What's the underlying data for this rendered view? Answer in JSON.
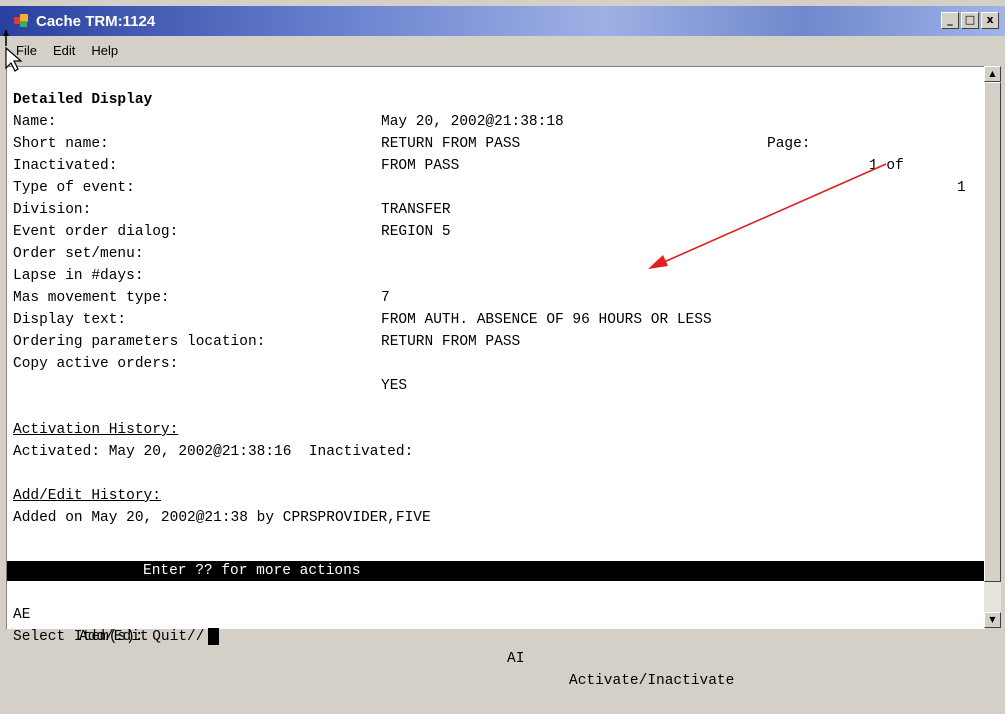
{
  "window": {
    "title": "Cache TRM:1124",
    "controls": [
      "_",
      "□",
      "x"
    ]
  },
  "menu": [
    "File",
    "Edit",
    "Help"
  ],
  "screen": {
    "header": {
      "left": "Detailed Display",
      "date": "May 20, 2002@21:38:18",
      "page_label": "Page:",
      "page_current": "1 of",
      "page_total": "1"
    },
    "fields": [
      {
        "label": "Name:",
        "value": "RETURN FROM PASS"
      },
      {
        "label": "Short name:",
        "value": "FROM PASS"
      },
      {
        "label": "Inactivated:",
        "value": ""
      },
      {
        "label": "Type of event:",
        "value": "TRANSFER"
      },
      {
        "label": "Division:",
        "value": "REGION 5"
      },
      {
        "label": "Event order dialog:",
        "value": ""
      },
      {
        "label": "Order set/menu:",
        "value": ""
      },
      {
        "label": "Lapse in #days:",
        "value": "7"
      },
      {
        "label": "Mas movement type:",
        "value": "FROM AUTH. ABSENCE OF 96 HOURS OR LESS"
      },
      {
        "label": "Display text:",
        "value": "RETURN FROM PASS"
      },
      {
        "label": "Ordering parameters location:",
        "value": ""
      },
      {
        "label": "Copy active orders:",
        "value": "YES"
      }
    ],
    "activation_history": {
      "heading": "Activation History:",
      "line": "Activated: May 20, 2002@21:38:16  Inactivated:"
    },
    "add_edit_history": {
      "heading": "Add/Edit History:",
      "line": "Added on May 20, 2002@21:38 by CPRSPROVIDER,FIVE"
    },
    "status_bar": "Enter ?? for more actions",
    "actions": [
      {
        "code": "AE",
        "label": "Add/Edit"
      },
      {
        "code": "AI",
        "label": "Activate/Inactivate"
      }
    ],
    "prompt": "Select Item(s): Quit//"
  },
  "colors": {
    "annotation_arrow": "#e02020",
    "title_gradient_start": "#2a3fa0"
  }
}
